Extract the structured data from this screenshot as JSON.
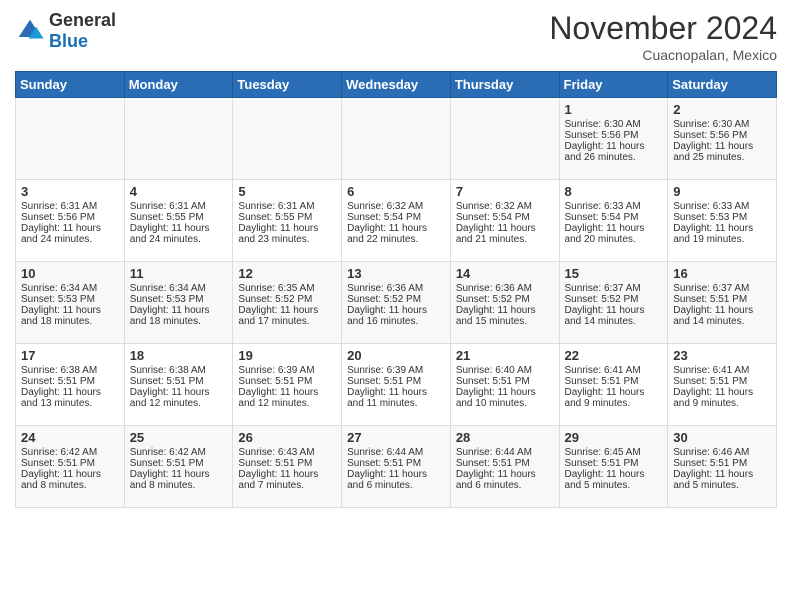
{
  "header": {
    "logo_general": "General",
    "logo_blue": "Blue",
    "month_title": "November 2024",
    "location": "Cuacnopalan, Mexico"
  },
  "days_of_week": [
    "Sunday",
    "Monday",
    "Tuesday",
    "Wednesday",
    "Thursday",
    "Friday",
    "Saturday"
  ],
  "weeks": [
    [
      {
        "day": "",
        "info": ""
      },
      {
        "day": "",
        "info": ""
      },
      {
        "day": "",
        "info": ""
      },
      {
        "day": "",
        "info": ""
      },
      {
        "day": "",
        "info": ""
      },
      {
        "day": "1",
        "info": "Sunrise: 6:30 AM\nSunset: 5:56 PM\nDaylight: 11 hours and 26 minutes."
      },
      {
        "day": "2",
        "info": "Sunrise: 6:30 AM\nSunset: 5:56 PM\nDaylight: 11 hours and 25 minutes."
      }
    ],
    [
      {
        "day": "3",
        "info": "Sunrise: 6:31 AM\nSunset: 5:56 PM\nDaylight: 11 hours and 24 minutes."
      },
      {
        "day": "4",
        "info": "Sunrise: 6:31 AM\nSunset: 5:55 PM\nDaylight: 11 hours and 24 minutes."
      },
      {
        "day": "5",
        "info": "Sunrise: 6:31 AM\nSunset: 5:55 PM\nDaylight: 11 hours and 23 minutes."
      },
      {
        "day": "6",
        "info": "Sunrise: 6:32 AM\nSunset: 5:54 PM\nDaylight: 11 hours and 22 minutes."
      },
      {
        "day": "7",
        "info": "Sunrise: 6:32 AM\nSunset: 5:54 PM\nDaylight: 11 hours and 21 minutes."
      },
      {
        "day": "8",
        "info": "Sunrise: 6:33 AM\nSunset: 5:54 PM\nDaylight: 11 hours and 20 minutes."
      },
      {
        "day": "9",
        "info": "Sunrise: 6:33 AM\nSunset: 5:53 PM\nDaylight: 11 hours and 19 minutes."
      }
    ],
    [
      {
        "day": "10",
        "info": "Sunrise: 6:34 AM\nSunset: 5:53 PM\nDaylight: 11 hours and 18 minutes."
      },
      {
        "day": "11",
        "info": "Sunrise: 6:34 AM\nSunset: 5:53 PM\nDaylight: 11 hours and 18 minutes."
      },
      {
        "day": "12",
        "info": "Sunrise: 6:35 AM\nSunset: 5:52 PM\nDaylight: 11 hours and 17 minutes."
      },
      {
        "day": "13",
        "info": "Sunrise: 6:36 AM\nSunset: 5:52 PM\nDaylight: 11 hours and 16 minutes."
      },
      {
        "day": "14",
        "info": "Sunrise: 6:36 AM\nSunset: 5:52 PM\nDaylight: 11 hours and 15 minutes."
      },
      {
        "day": "15",
        "info": "Sunrise: 6:37 AM\nSunset: 5:52 PM\nDaylight: 11 hours and 14 minutes."
      },
      {
        "day": "16",
        "info": "Sunrise: 6:37 AM\nSunset: 5:51 PM\nDaylight: 11 hours and 14 minutes."
      }
    ],
    [
      {
        "day": "17",
        "info": "Sunrise: 6:38 AM\nSunset: 5:51 PM\nDaylight: 11 hours and 13 minutes."
      },
      {
        "day": "18",
        "info": "Sunrise: 6:38 AM\nSunset: 5:51 PM\nDaylight: 11 hours and 12 minutes."
      },
      {
        "day": "19",
        "info": "Sunrise: 6:39 AM\nSunset: 5:51 PM\nDaylight: 11 hours and 12 minutes."
      },
      {
        "day": "20",
        "info": "Sunrise: 6:39 AM\nSunset: 5:51 PM\nDaylight: 11 hours and 11 minutes."
      },
      {
        "day": "21",
        "info": "Sunrise: 6:40 AM\nSunset: 5:51 PM\nDaylight: 11 hours and 10 minutes."
      },
      {
        "day": "22",
        "info": "Sunrise: 6:41 AM\nSunset: 5:51 PM\nDaylight: 11 hours and 9 minutes."
      },
      {
        "day": "23",
        "info": "Sunrise: 6:41 AM\nSunset: 5:51 PM\nDaylight: 11 hours and 9 minutes."
      }
    ],
    [
      {
        "day": "24",
        "info": "Sunrise: 6:42 AM\nSunset: 5:51 PM\nDaylight: 11 hours and 8 minutes."
      },
      {
        "day": "25",
        "info": "Sunrise: 6:42 AM\nSunset: 5:51 PM\nDaylight: 11 hours and 8 minutes."
      },
      {
        "day": "26",
        "info": "Sunrise: 6:43 AM\nSunset: 5:51 PM\nDaylight: 11 hours and 7 minutes."
      },
      {
        "day": "27",
        "info": "Sunrise: 6:44 AM\nSunset: 5:51 PM\nDaylight: 11 hours and 6 minutes."
      },
      {
        "day": "28",
        "info": "Sunrise: 6:44 AM\nSunset: 5:51 PM\nDaylight: 11 hours and 6 minutes."
      },
      {
        "day": "29",
        "info": "Sunrise: 6:45 AM\nSunset: 5:51 PM\nDaylight: 11 hours and 5 minutes."
      },
      {
        "day": "30",
        "info": "Sunrise: 6:46 AM\nSunset: 5:51 PM\nDaylight: 11 hours and 5 minutes."
      }
    ]
  ]
}
